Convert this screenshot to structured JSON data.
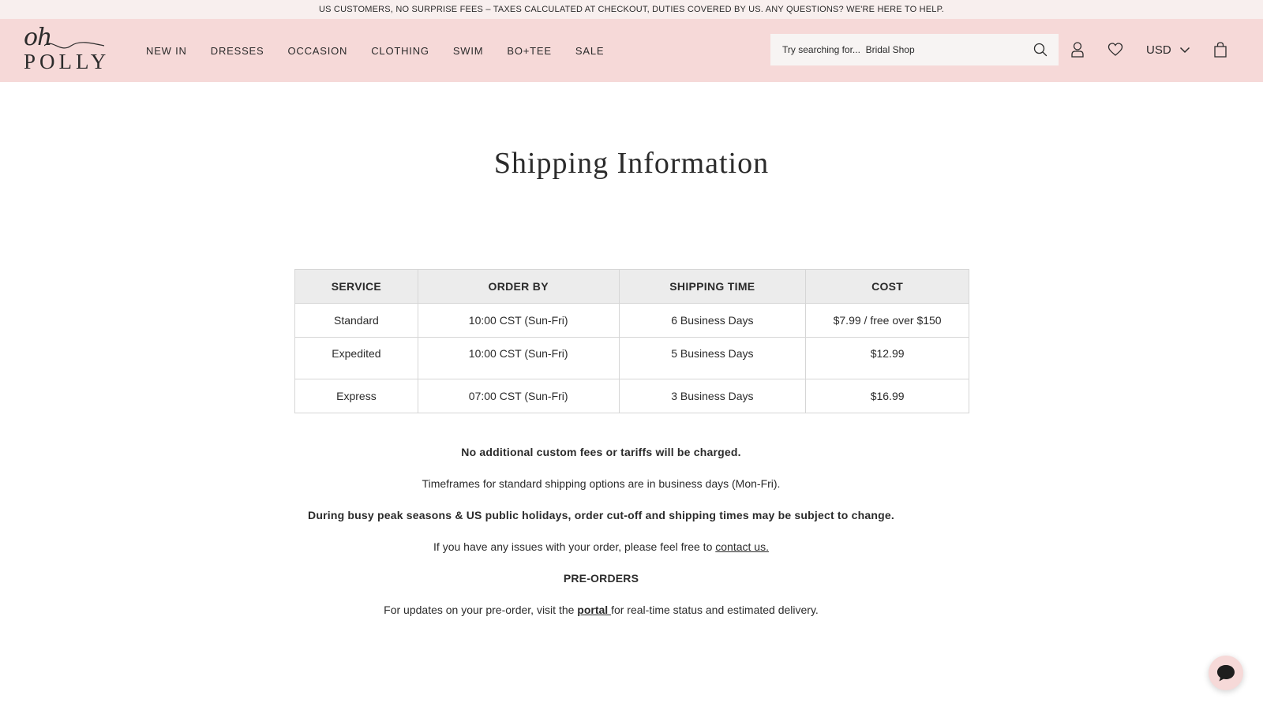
{
  "announcement": {
    "text": "US CUSTOMERS, NO SURPRISE FEES – TAXES CALCULATED AT CHECKOUT, DUTIES COVERED BY US. ANY QUESTIONS? WE'RE HERE TO HELP."
  },
  "logo": {
    "top": "oh",
    "bottom": "POLLY"
  },
  "nav": {
    "items": [
      {
        "label": "NEW IN"
      },
      {
        "label": "DRESSES"
      },
      {
        "label": "OCCASION"
      },
      {
        "label": "CLOTHING"
      },
      {
        "label": "SWIM"
      },
      {
        "label": "BO+TEE"
      },
      {
        "label": "SALE"
      }
    ]
  },
  "search": {
    "placeholder": "Try searching for...  Bridal Shop",
    "icon": "search-icon"
  },
  "header_icons": {
    "account": "user-icon",
    "wishlist": "heart-icon",
    "bag": "shopping-bag-icon"
  },
  "currency": {
    "selected": "USD"
  },
  "page": {
    "title": "Shipping Information"
  },
  "shipping_table": {
    "headers": [
      "SERVICE",
      "ORDER BY",
      "SHIPPING TIME",
      "COST"
    ],
    "rows": [
      {
        "service": "Standard",
        "order_by": "10:00 CST (Sun-Fri)",
        "shipping_time": "6 Business Days",
        "cost": "$7.99 / free over $150"
      },
      {
        "service": "Expedited",
        "order_by": "10:00 CST (Sun-Fri)",
        "shipping_time": "5 Business Days",
        "cost": "$12.99"
      },
      {
        "service": "Express",
        "order_by": "07:00 CST (Sun-Fri)",
        "shipping_time": "3 Business Days",
        "cost": "$16.99"
      }
    ]
  },
  "notes": {
    "no_fees": "No additional custom fees or tariffs will be charged.",
    "timeframes": "Timeframes for standard shipping options are in business days (Mon-Fri).",
    "peak": "During busy peak seasons & US public holidays, order cut-off and shipping times may be subject to change.",
    "issues_prefix": "If you have any issues with your order, please feel free to ",
    "issues_link": "contact us.",
    "preorders_heading": "PRE-ORDERS",
    "preorder_prefix": "For updates on your pre-order, visit the ",
    "preorder_link": "portal ",
    "preorder_suffix": "for real-time status and estimated delivery."
  },
  "colors": {
    "header_bg": "#f6d9d8",
    "announcement_bg": "#f8efee",
    "table_header_bg": "#ececec",
    "text": "#2b2b2b"
  },
  "chat": {
    "icon": "chat-bubble-icon"
  }
}
